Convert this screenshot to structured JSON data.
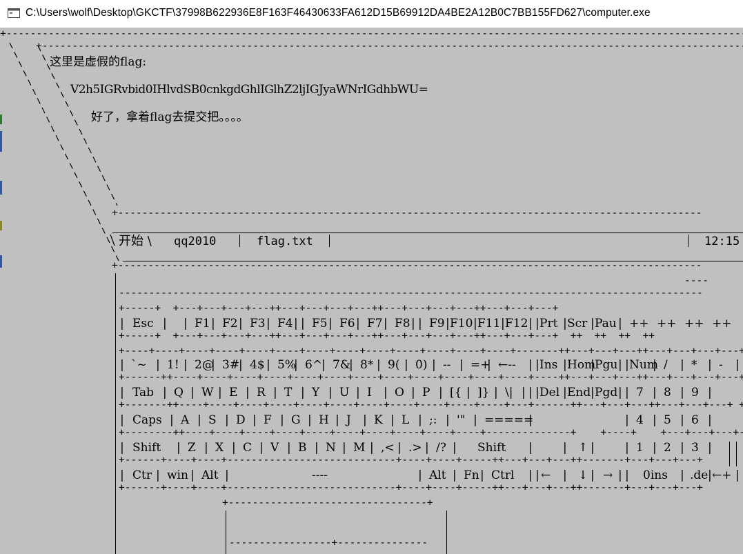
{
  "window": {
    "title": "C:\\Users\\wolf\\Desktop\\GKCTF\\37998B622936E8F163F46430633FA612D15B69912DA4BE2A12B0C7BB155FD627\\computer.exe"
  },
  "screen": {
    "message_line1": "这里是虚假的flag:",
    "message_line2": "V2h5IGRvbid0IHlvdSB0cnkgdGhlIGlhZ2ljIGJyaWNrIGdhbWU=",
    "message_line3": "好了，拿着flag去提交把。。。。"
  },
  "taskbar": {
    "start": "开始 \\",
    "item1": "qq2010",
    "item2": "flag.txt",
    "clock": "12:15"
  },
  "keyboard": {
    "row0": [
      "Esc",
      "F1",
      "F2",
      "F3",
      "F4",
      "F5",
      "F6",
      "F7",
      "F8",
      "F9",
      "F10",
      "F11",
      "F12",
      "Prt",
      "Scr",
      "Pau",
      "++",
      "++",
      "++",
      "++"
    ],
    "row1": [
      "`~",
      "1!",
      "2@",
      "3#",
      "4$",
      "5%",
      "6^",
      "7&",
      "8*",
      "9(",
      "0)",
      "--",
      "=+",
      "←--",
      "Ins",
      "Hom",
      "Pgu",
      "Num",
      "/",
      "*",
      "-"
    ],
    "row2": [
      "Tab",
      "Q",
      "W",
      "E",
      "R",
      "T",
      "Y",
      "U",
      "I",
      "O",
      "P",
      "[{",
      "]}",
      "\\|",
      "Del",
      "End",
      "Pgd",
      "7",
      "8",
      "9"
    ],
    "row3": [
      "Caps",
      "A",
      "S",
      "D",
      "F",
      "G",
      "H",
      "J",
      "K",
      "L",
      ";:",
      "'\"",
      "=====",
      "4",
      "5",
      "6"
    ],
    "row4": [
      "Shift",
      "Z",
      "X",
      "C",
      "V",
      "B",
      "N",
      "M",
      ",<",
      ".>",
      "/?",
      "Shift",
      "↑",
      "1",
      "2",
      "3"
    ],
    "row5": [
      "Ctr",
      "win",
      "Alt",
      "----",
      "Alt",
      "Fn",
      "Ctrl",
      "←",
      "↓",
      "→",
      "0ins",
      ".de",
      "←+"
    ],
    "led": "----",
    "led_under": "++  ++  ++  ++"
  },
  "colors": {
    "console_bg": "#c0c0c0",
    "text": "#000000",
    "titlebar_bg": "#ffffff"
  }
}
